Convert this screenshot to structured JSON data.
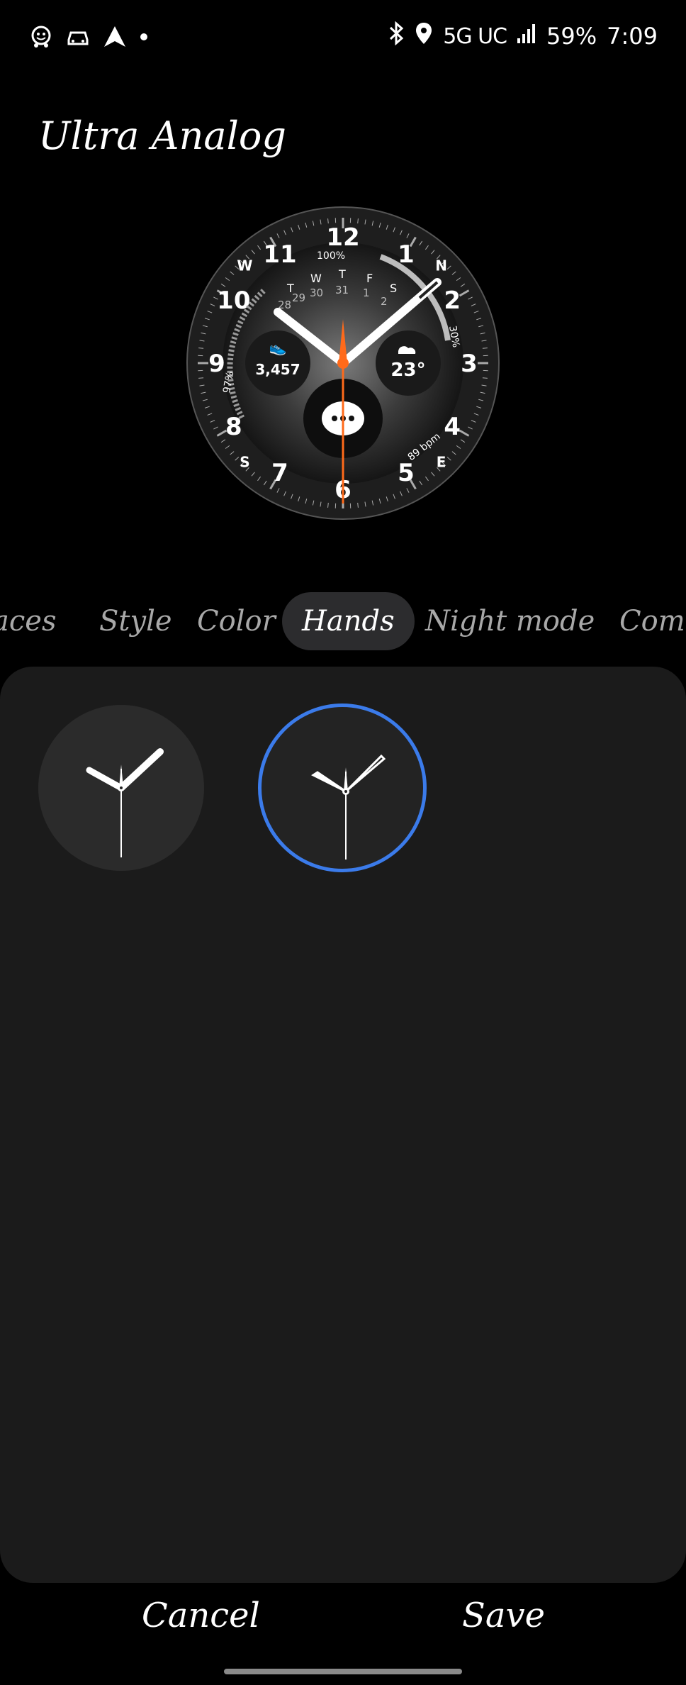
{
  "status_bar": {
    "network": "5G UC",
    "battery": "59%",
    "time": "7:09"
  },
  "header": {
    "title": "Ultra Analog"
  },
  "watch_face": {
    "battery_pct": "100%",
    "days": [
      "T",
      "W",
      "T",
      "F",
      "S"
    ],
    "dates": [
      "28",
      "29",
      "30",
      "31",
      "1",
      "2"
    ],
    "steps": "3,457",
    "temperature": "23°",
    "humidity": "97%",
    "ring_pct": "30%",
    "heart_rate": "89 bpm",
    "hour_markers": [
      "12",
      "1",
      "2",
      "3",
      "4",
      "5",
      "6",
      "7",
      "8",
      "9",
      "10",
      "11"
    ],
    "compass": [
      "N",
      "E",
      "S",
      "W"
    ],
    "accent_color": "#ff6a1a"
  },
  "tabs": [
    {
      "label": "Faces"
    },
    {
      "label": "Style"
    },
    {
      "label": "Color"
    },
    {
      "label": "Hands",
      "selected": true
    },
    {
      "label": "Night mode"
    },
    {
      "label": "Complications"
    }
  ],
  "hand_options": [
    {
      "name": "hands-style-1",
      "selected": false
    },
    {
      "name": "hands-style-2",
      "selected": true
    }
  ],
  "selection_color": "#3b7bea",
  "footer": {
    "cancel": "Cancel",
    "save": "Save"
  }
}
